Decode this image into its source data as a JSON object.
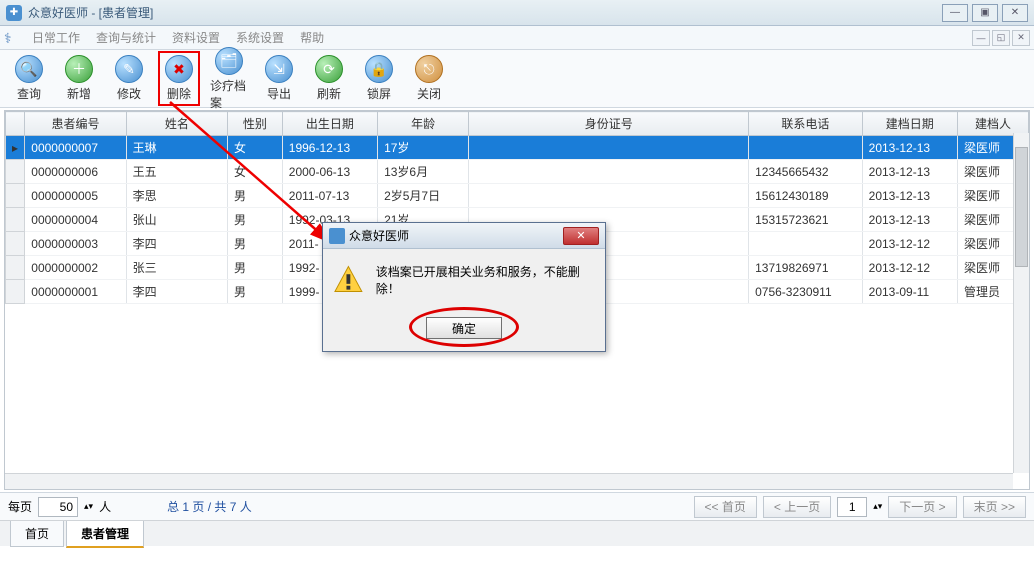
{
  "window": {
    "title": "众意好医师 - [患者管理]"
  },
  "menu": {
    "items": [
      "日常工作",
      "查询与统计",
      "资料设置",
      "系统设置",
      "帮助"
    ]
  },
  "toolbar": {
    "query": "查询",
    "add": "新增",
    "edit": "修改",
    "delete": "删除",
    "archive": "诊疗档案",
    "export": "导出",
    "refresh": "刷新",
    "lock": "锁屏",
    "close": "关闭"
  },
  "columns": [
    "患者编号",
    "姓名",
    "性别",
    "出生日期",
    "年龄",
    "身份证号",
    "联系电话",
    "建档日期",
    "建档人"
  ],
  "rows": [
    {
      "id": "0000000007",
      "name": "王琳",
      "sex": "女",
      "dob": "1996-12-13",
      "age": "17岁",
      "idcard": "",
      "phone": "",
      "filed": "2013-12-13",
      "by": "梁医师",
      "sel": true
    },
    {
      "id": "0000000006",
      "name": "王五",
      "sex": "女",
      "dob": "2000-06-13",
      "age": "13岁6月",
      "idcard": "",
      "phone": "12345665432",
      "filed": "2013-12-13",
      "by": "梁医师"
    },
    {
      "id": "0000000005",
      "name": "李思",
      "sex": "男",
      "dob": "2011-07-13",
      "age": "2岁5月7日",
      "idcard": "",
      "phone": "15612430189",
      "filed": "2013-12-13",
      "by": "梁医师"
    },
    {
      "id": "0000000004",
      "name": "张山",
      "sex": "男",
      "dob": "1992-03-13",
      "age": "21岁",
      "idcard": "",
      "phone": "15315723621",
      "filed": "2013-12-13",
      "by": "梁医师"
    },
    {
      "id": "0000000003",
      "name": "李四",
      "sex": "男",
      "dob": "2011-",
      "age": "",
      "idcard": "",
      "phone": "",
      "filed": "2013-12-12",
      "by": "梁医师"
    },
    {
      "id": "0000000002",
      "name": "张三",
      "sex": "男",
      "dob": "1992-",
      "age": "",
      "idcard": "",
      "phone": "13719826971",
      "filed": "2013-12-12",
      "by": "梁医师"
    },
    {
      "id": "0000000001",
      "name": "李四",
      "sex": "男",
      "dob": "1999-",
      "age": "",
      "idcard": "",
      "phone": "0756-3230911",
      "filed": "2013-09-11",
      "by": "管理员"
    }
  ],
  "pager": {
    "perpage_label": "每页",
    "perpage_value": "50",
    "unit": "人",
    "summary": "总 1 页 / 共 7 人",
    "first": "<< 首页",
    "prev": "< 上一页",
    "page": "1",
    "next": "下一页 >",
    "last": "末页 >>"
  },
  "tabs": {
    "home": "首页",
    "patients": "患者管理"
  },
  "dialog": {
    "title": "众意好医师",
    "message": "该档案已开展相关业务和服务，不能删除！",
    "ok": "确定"
  }
}
